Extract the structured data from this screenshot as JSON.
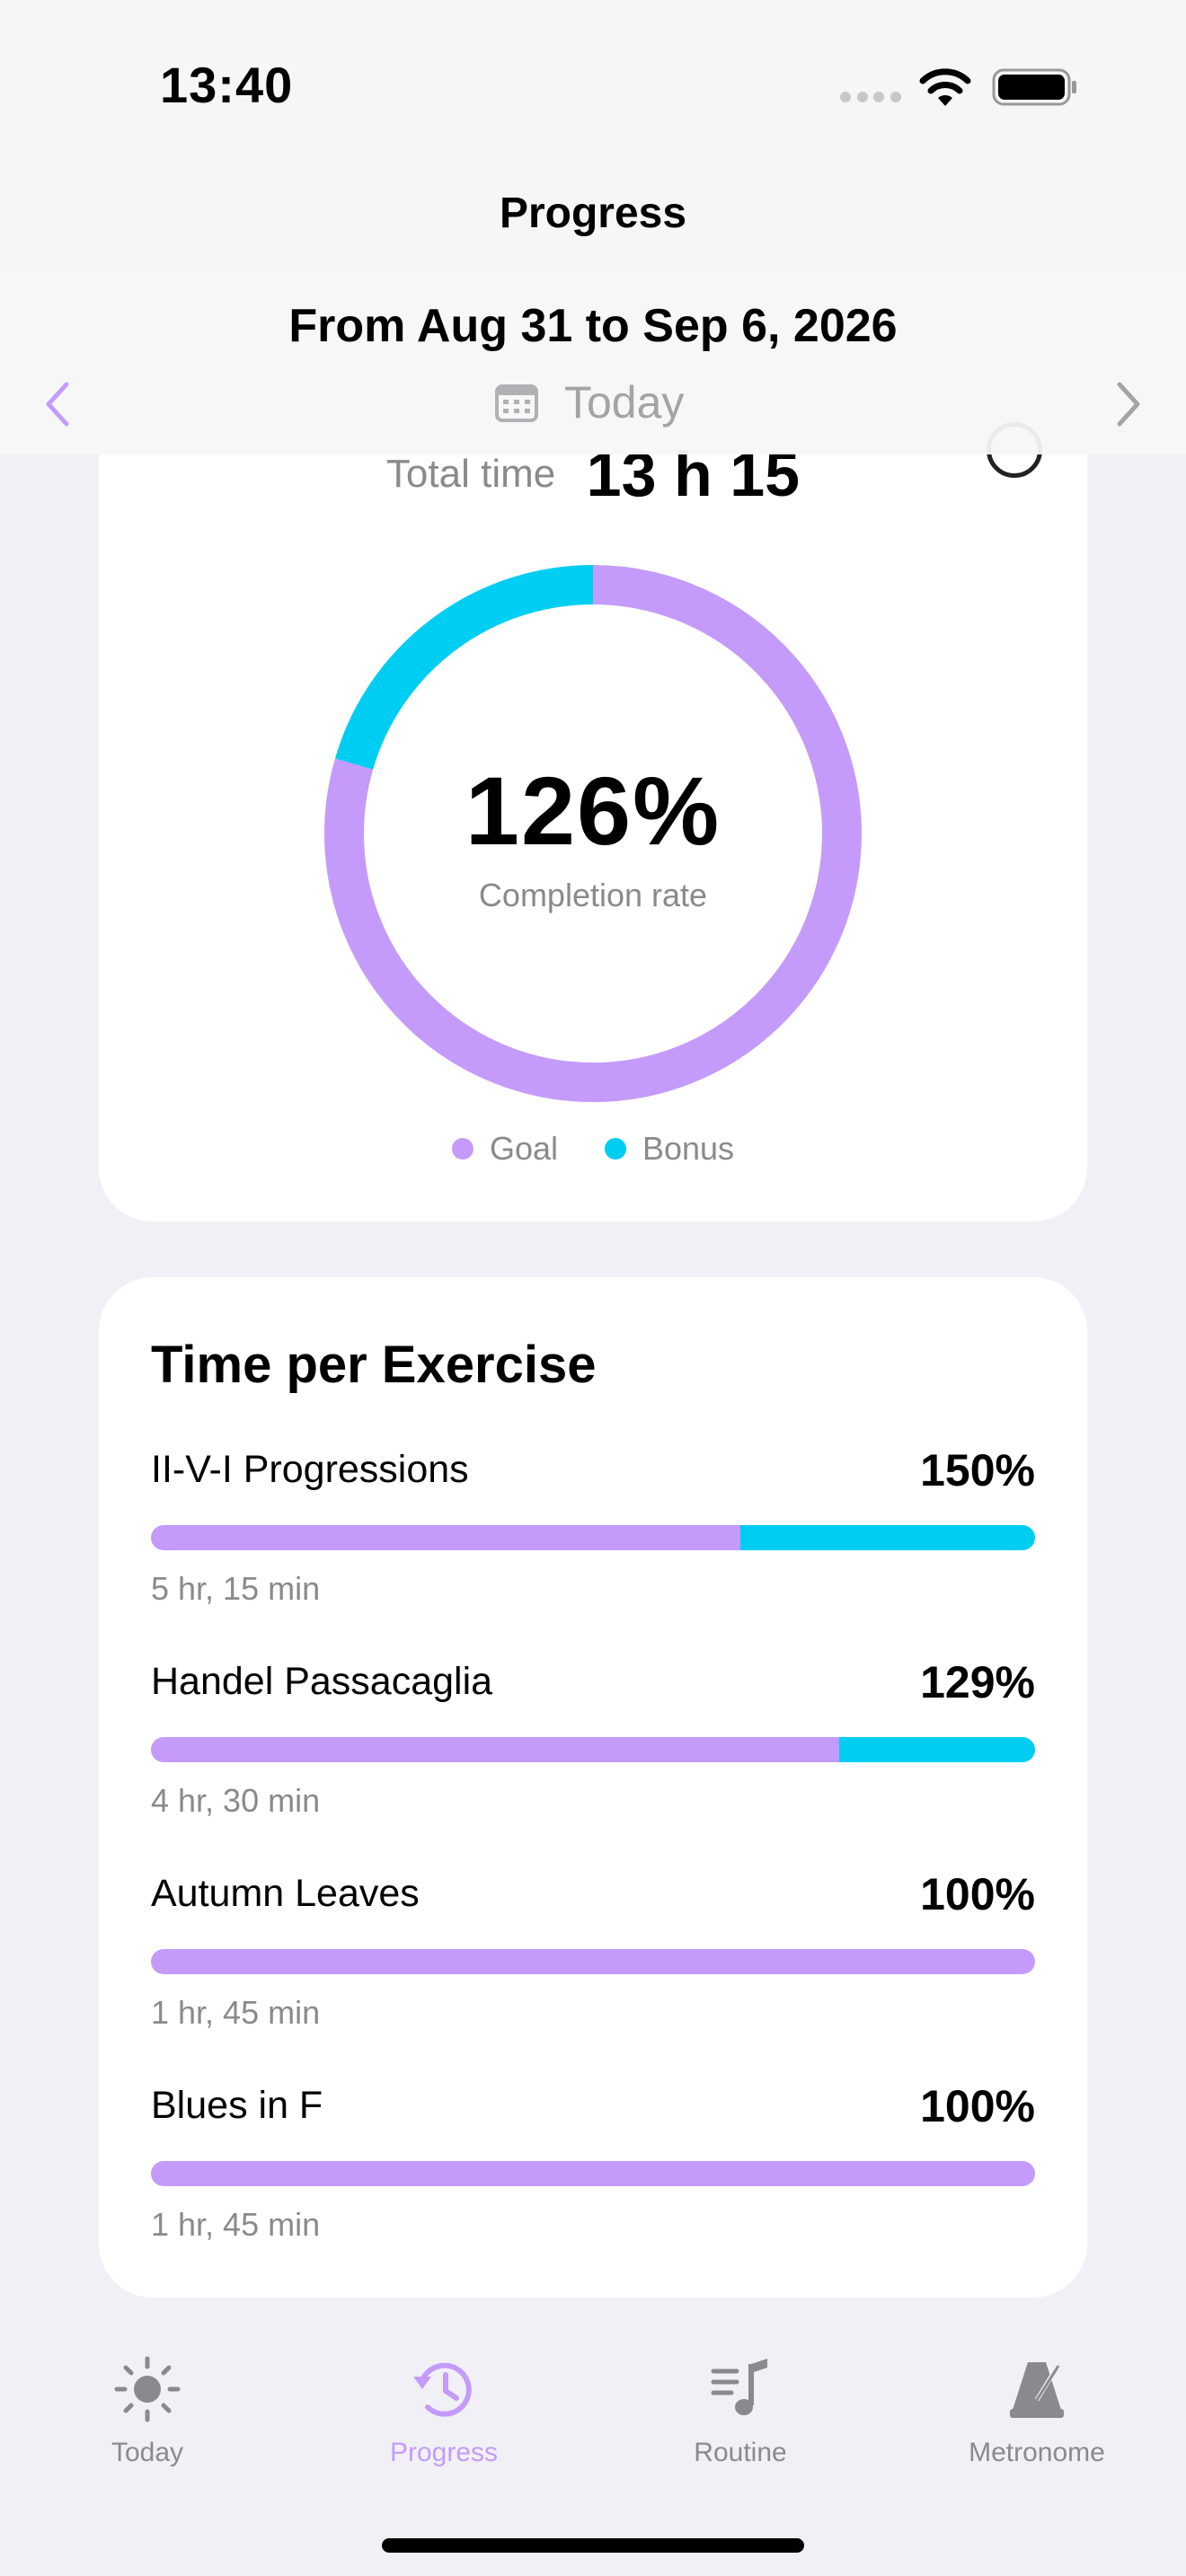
{
  "status_bar": {
    "time": "13:40"
  },
  "nav": {
    "title": "Progress"
  },
  "range": {
    "title": "From Aug 31 to Sep 6, 2026",
    "today_label": "Today"
  },
  "summary": {
    "total_label": "Total time",
    "total_value": "13 h 15",
    "completion_value": "126%",
    "completion_caption": "Completion rate",
    "goal_fraction": 0.795,
    "bonus_fraction": 0.205,
    "legend": {
      "goal": "Goal",
      "bonus": "Bonus"
    }
  },
  "colors": {
    "accent": "#c49bfa",
    "bonus": "#00cdf2",
    "secondary_text": "#8a8a8e"
  },
  "exercises": {
    "title": "Time per Exercise",
    "items": [
      {
        "name": "II-V-I Progressions",
        "percent": "150%",
        "time": "5 hr, 15 min",
        "goal_fraction": 0.667,
        "bonus_fraction": 0.333
      },
      {
        "name": "Handel Passacaglia",
        "percent": "129%",
        "time": "4 hr, 30 min",
        "goal_fraction": 0.778,
        "bonus_fraction": 0.222
      },
      {
        "name": "Autumn Leaves",
        "percent": "100%",
        "time": "1 hr, 45 min",
        "goal_fraction": 1.0,
        "bonus_fraction": 0
      },
      {
        "name": "Blues in F",
        "percent": "100%",
        "time": "1 hr, 45 min",
        "goal_fraction": 1.0,
        "bonus_fraction": 0
      }
    ]
  },
  "tabs": [
    {
      "label": "Today",
      "icon": "sun-icon",
      "active": false
    },
    {
      "label": "Progress",
      "icon": "history-clock-icon",
      "active": true
    },
    {
      "label": "Routine",
      "icon": "music-list-icon",
      "active": false
    },
    {
      "label": "Metronome",
      "icon": "metronome-icon",
      "active": false
    }
  ]
}
